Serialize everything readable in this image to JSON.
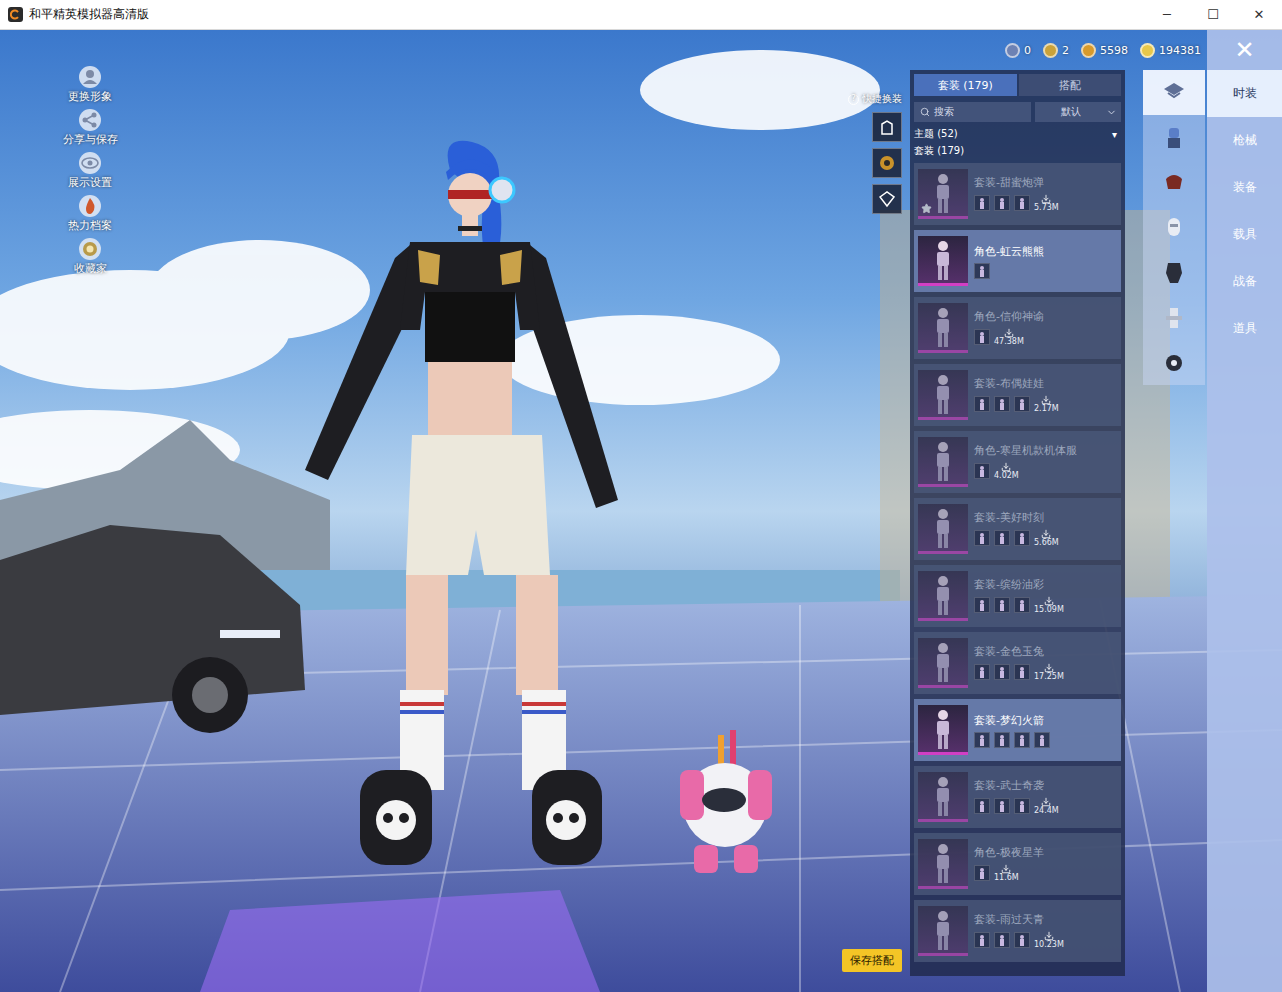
{
  "window": {
    "title": "和平精英模拟器高清版",
    "controls": [
      "─",
      "☐",
      "✕"
    ]
  },
  "left_menu": [
    {
      "label": "更换形象"
    },
    {
      "label": "分享与保存"
    },
    {
      "label": "展示设置"
    },
    {
      "label": "热力档案"
    },
    {
      "label": "收藏家"
    }
  ],
  "currencies": [
    {
      "value": "0",
      "color": "#6d82b4"
    },
    {
      "value": "2",
      "color": "#c9a23a"
    },
    {
      "value": "5598",
      "color": "#d89a2c"
    },
    {
      "value": "194381",
      "color": "#e8c84a"
    }
  ],
  "close": "✕",
  "quick_change": {
    "label": "快捷换装",
    "help": "?"
  },
  "panel": {
    "tabs": [
      {
        "label": "套装 (179)",
        "selected": true
      },
      {
        "label": "搭配",
        "selected": false
      }
    ],
    "search": {
      "placeholder": "搜索"
    },
    "sort": {
      "value": "默认"
    },
    "theme_filter": {
      "label": "主题 (52)",
      "arrow": "▾"
    },
    "section_label": "套装 (179)",
    "items": [
      {
        "title": "套装-甜蜜炮弹",
        "size": "5.73M",
        "dimmed": true,
        "starred": true,
        "parts": 3
      },
      {
        "title": "角色-虹云熊熊",
        "dimmed": false,
        "starred": false,
        "parts": 1
      },
      {
        "title": "角色-信仰神谕",
        "size": "47.38M",
        "dimmed": true,
        "starred": false,
        "parts": 1
      },
      {
        "title": "套装-布偶娃娃",
        "size": "2.17M",
        "dimmed": true,
        "starred": false,
        "parts": 3
      },
      {
        "title": "角色-寒星机款机体服",
        "size": "4.02M",
        "dimmed": true,
        "starred": false,
        "parts": 1
      },
      {
        "title": "套装-美好时刻",
        "size": "5.66M",
        "dimmed": true,
        "starred": false,
        "parts": 3
      },
      {
        "title": "套装-缤纷油彩",
        "size": "15.09M",
        "dimmed": true,
        "starred": false,
        "parts": 3
      },
      {
        "title": "套装-金色玉兔",
        "size": "17.25M",
        "dimmed": true,
        "starred": false,
        "parts": 3
      },
      {
        "title": "套装-梦幻火箭",
        "dimmed": false,
        "starred": false,
        "parts": 4
      },
      {
        "title": "套装-武士奇袭",
        "size": "24.4M",
        "dimmed": true,
        "starred": false,
        "parts": 3
      },
      {
        "title": "角色-极夜星羊",
        "size": "11.6M",
        "dimmed": true,
        "starred": false,
        "parts": 1
      },
      {
        "title": "套装-雨过天青",
        "size": "10.23M",
        "dimmed": true,
        "starred": false,
        "parts": 3
      }
    ]
  },
  "save_button": "保存搭配",
  "icon_tabs": [
    {
      "selected": true
    },
    {
      "selected": false
    },
    {
      "selected": false
    },
    {
      "selected": false
    },
    {
      "selected": false
    },
    {
      "selected": false
    },
    {
      "selected": false
    }
  ],
  "categories": [
    {
      "label": "时装",
      "selected": true
    },
    {
      "label": "枪械",
      "selected": false
    },
    {
      "label": "装备",
      "selected": false
    },
    {
      "label": "载具",
      "selected": false
    },
    {
      "label": "战备",
      "selected": false
    },
    {
      "label": "道具",
      "selected": false
    }
  ]
}
